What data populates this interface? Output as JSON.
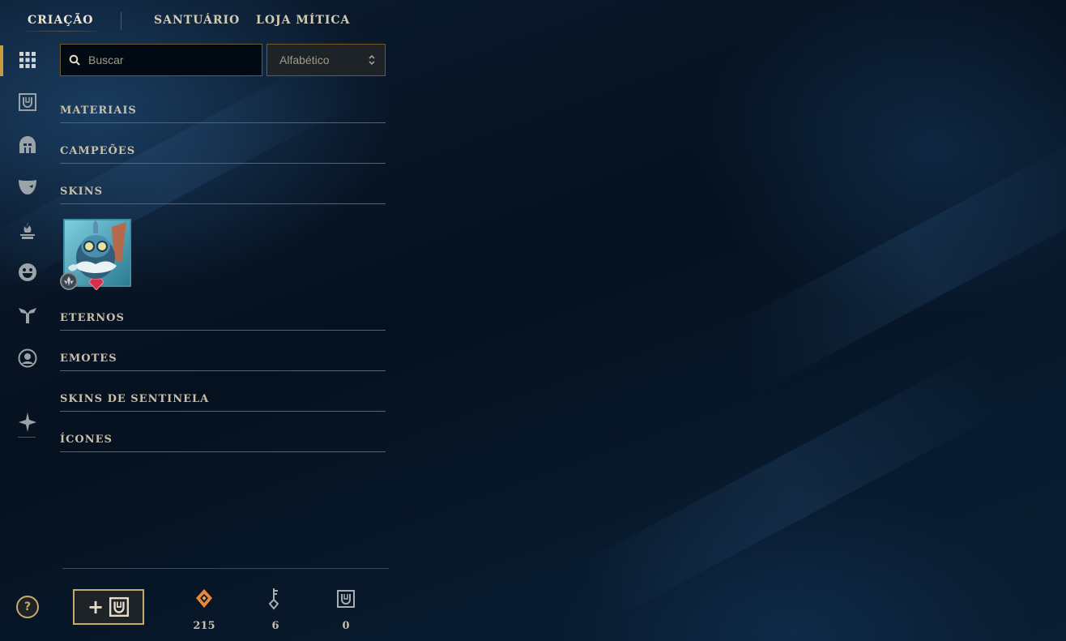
{
  "nav": {
    "tabs": [
      {
        "label": "CRIAÇÃO",
        "active": true
      },
      {
        "label": "SANTUÁRIO",
        "active": false
      },
      {
        "label": "LOJA MÍTICA",
        "active": false
      }
    ]
  },
  "siderail": {
    "items": [
      {
        "icon": "grid-icon",
        "active": true
      },
      {
        "icon": "chest-icon"
      },
      {
        "icon": "helmet-icon"
      },
      {
        "icon": "mask-icon"
      },
      {
        "icon": "flame-icon"
      },
      {
        "icon": "smiley-icon"
      },
      {
        "icon": "ward-icon"
      },
      {
        "icon": "profile-icon"
      },
      {
        "icon": "sentinel-icon"
      }
    ]
  },
  "filters": {
    "search_placeholder": "Buscar",
    "sort_value": "Alfabético"
  },
  "categories": [
    {
      "label": "MATERIAIS"
    },
    {
      "label": "CAMPEÕES"
    },
    {
      "label": "SKINS"
    },
    {
      "label": "ETERNOS"
    },
    {
      "label": "EMOTES"
    },
    {
      "label": "SKINS DE SENTINELA"
    },
    {
      "label": "ÍCONES"
    }
  ],
  "skins_items": [
    {
      "icon": "skin-shard-tile",
      "rarity_icon": "gem-icon",
      "badge_icon": "shard-badge-icon"
    }
  ],
  "footer": {
    "help_label": "?",
    "add_chest_label": "+",
    "currencies": [
      {
        "icon": "orange-essence-icon",
        "value": "215",
        "color": "#e8873a"
      },
      {
        "icon": "key-icon",
        "value": "6"
      },
      {
        "icon": "chest-icon",
        "value": "0"
      }
    ]
  },
  "colors": {
    "accent_gold": "#c8aa6e",
    "divider_gold": "#6f5f3c",
    "text": "#c8bfa8"
  }
}
